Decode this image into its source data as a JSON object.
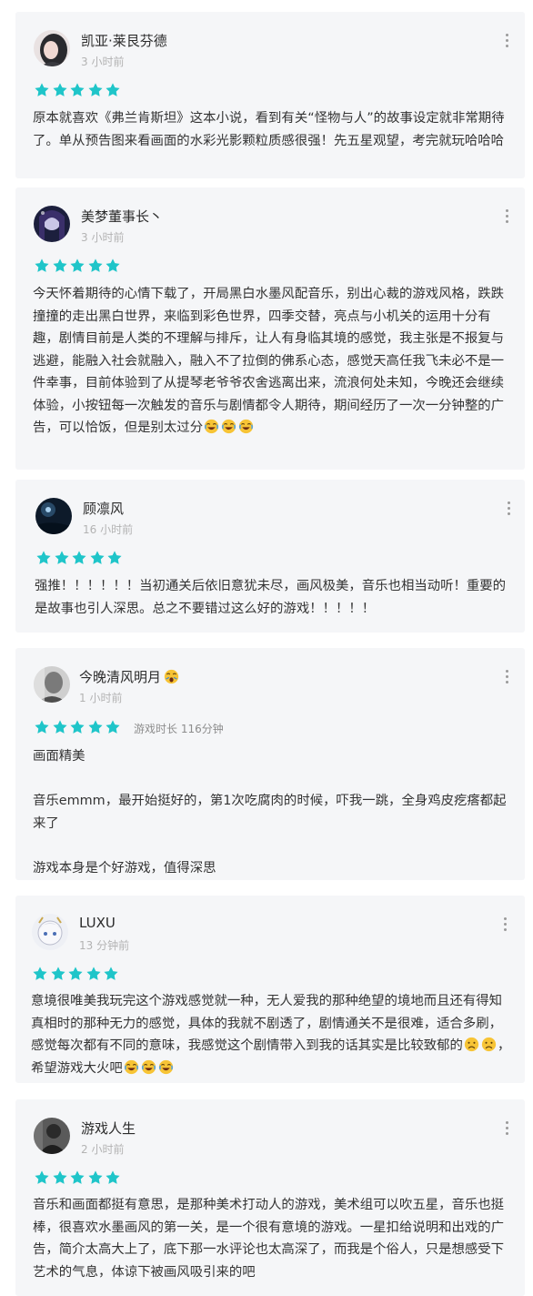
{
  "colors": {
    "star": "#1fc5c9",
    "card_bg": "#f5f6f8",
    "time": "#b3b3b3"
  },
  "reviews": [
    {
      "username": "凯亚·莱艮芬德",
      "time": "3 小时前",
      "rating": 5,
      "content": "原本就喜欢《弗兰肯斯坦》这本小说，看到有关“怪物与人”的故事设定就非常期待了。单从预告图来看画面的水彩光影颗粒质感很强！先五星观望，考完就玩哈哈哈",
      "avatar_icon": "avatar-dark-hair-icon"
    },
    {
      "username": "美梦董事长丶",
      "time": "3 小时前",
      "rating": 5,
      "content": "今天怀着期待的心情下载了，开局黑白水墨风配音乐，别出心裁的游戏风格，跌跌撞撞的走出黑白世界，来临到彩色世界，四季交替，亮点与小机关的运用十分有趣，剧情目前是人类的不理解与排斥，让人有身临其境的感觉，我主张是不报复与逃避，能融入社会就融入，融入不了拉倒的佛系心态，感觉天高任我飞未必不是一件幸事，目前体验到了从提琴老爷爷农舍逃离出来，流浪何处未知，今晚还会继续体验，小按钮每一次触发的音乐与剧情都令人期待，期间经历了一次一分钟整的广告，可以恰饭，但是别太过分",
      "emojis": [
        "laugh-cry",
        "laugh-cry",
        "laugh-cry"
      ],
      "avatar_icon": "avatar-anime-girl-icon"
    },
    {
      "username": "顾凛风",
      "time": "16 小时前",
      "rating": 5,
      "content": "强推！！！！！！当初通关后依旧意犹未尽，画风极美，音乐也相当动听！重要的是故事也引人深思。总之不要错过这么好的游戏！！！！！",
      "avatar_icon": "avatar-night-sky-icon"
    },
    {
      "username": "今晚清风明月",
      "username_emoji": "yawn",
      "time": "1 小时前",
      "rating": 5,
      "playtime": "游戏时长 116分钟",
      "content": "画面精美\n\n音乐emmm，最开始挺好的，第1次吃腐肉的时候，吓我一跳，全身鸡皮疙瘩都起来了\n\n游戏本身是个好游戏，值得深思",
      "avatar_icon": "avatar-grey-portrait-icon"
    },
    {
      "username": "LUXU",
      "time": "13 分钟前",
      "rating": 5,
      "content_before": "意境很唯美我玩完这个游戏感觉就一种，无人爱我的那种绝望的境地而且还有得知真相时的那种无力的感觉，具体的我就不剧透了，剧情通关不是很难，适合多刷，感觉每次都有不同的意味，我感觉这个剧情带入到我的话其实是比较致郁的",
      "emojis_mid": [
        "sad",
        "sad"
      ],
      "content_after": "，希望游戏大火吧",
      "emojis_end": [
        "laugh-cry",
        "laugh-cry",
        "laugh-cry"
      ],
      "avatar_icon": "avatar-white-hair-icon"
    },
    {
      "username": "游戏人生",
      "time": "2 小时前",
      "rating": 5,
      "content": "音乐和画面都挺有意思，是那种美术打动人的游戏，美术组可以吹五星，音乐也挺棒，很喜欢水墨画风的第一关，是一个很有意境的游戏。一星扣给说明和出戏的广告，简介太高大上了，底下那一水评论也太高深了，而我是个俗人，只是想感受下艺术的气息，体谅下被画风吸引来的吧",
      "avatar_icon": "avatar-dark-figure-icon"
    }
  ]
}
